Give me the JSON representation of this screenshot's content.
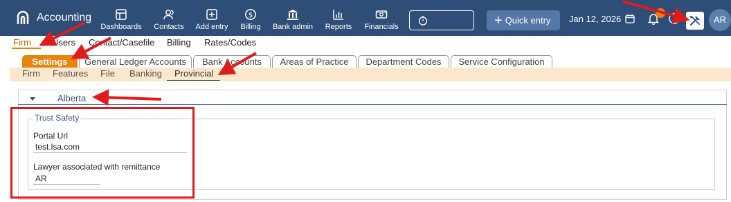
{
  "app": {
    "name": "Accounting",
    "icon": "app-logo-icon"
  },
  "nav": {
    "items": [
      {
        "label": "Dashboards",
        "icon": "dashboard-icon"
      },
      {
        "label": "Contacts",
        "icon": "contacts-icon"
      },
      {
        "label": "Add entry",
        "icon": "add-entry-icon"
      },
      {
        "label": "Billing",
        "icon": "dollar-icon"
      },
      {
        "label": "Bank admin",
        "icon": "bank-icon"
      },
      {
        "label": "Reports",
        "icon": "bar-chart-icon"
      },
      {
        "label": "Financials",
        "icon": "financials-icon"
      }
    ],
    "quick_entry": "Quick entry",
    "date": "Jan 12, 2026",
    "avatar_initials": "AR"
  },
  "menu": {
    "items": [
      "Firm",
      "Users",
      "Contact/Casefile",
      "Billing",
      "Rates/Codes"
    ],
    "active": "Firm"
  },
  "tabs": {
    "items": [
      "Settings",
      "General Ledger Accounts",
      "Bank Accounts",
      "Areas of Practice",
      "Department Codes",
      "Service Configuration"
    ],
    "active": "Settings"
  },
  "subtabs": {
    "items": [
      "Firm",
      "Features",
      "File",
      "Banking",
      "Provincial"
    ],
    "active": "Provincial"
  },
  "section": {
    "title": "Alberta"
  },
  "trust_safety": {
    "legend": "Trust Safety",
    "portal_url_label": "Portal Url",
    "portal_url_value": "test.lsa.com",
    "lawyer_label": "Lawyer associated with remittance",
    "lawyer_value": "AR"
  },
  "colors": {
    "topbar": "#2e4e78",
    "accent": "#e8830c",
    "annotation": "#e01b1b",
    "subbar": "#fbe7cc"
  }
}
